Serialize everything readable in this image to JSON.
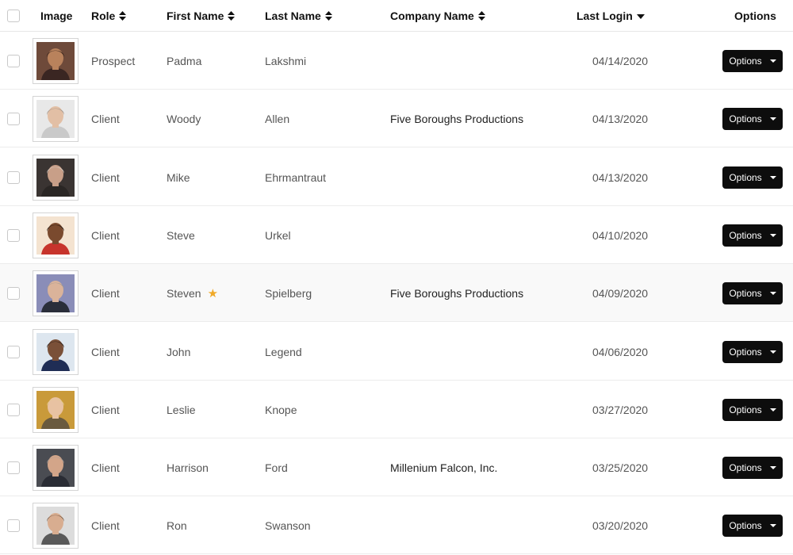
{
  "header": {
    "image": "Image",
    "role": "Role",
    "first_name": "First Name",
    "last_name": "Last Name",
    "company": "Company Name",
    "last_login": "Last Login",
    "options": "Options"
  },
  "rows": [
    {
      "role": "Prospect",
      "first": "Padma",
      "last": "Lakshmi",
      "company": "",
      "login": "04/14/2020",
      "options": "Options",
      "starred": false,
      "colors": {
        "bg": "#6e4a3a",
        "skin": "#b9825c",
        "hair": "#2a1a14",
        "shirt": "#3a2622"
      }
    },
    {
      "role": "Client",
      "first": "Woody",
      "last": "Allen",
      "company": "Five Boroughs Productions",
      "login": "04/13/2020",
      "options": "Options",
      "starred": false,
      "colors": {
        "bg": "#e8e8e8",
        "skin": "#e2bfa5",
        "hair": "#9a8f86",
        "shirt": "#c9c9c9"
      }
    },
    {
      "role": "Client",
      "first": "Mike",
      "last": "Ehrmantraut",
      "company": "",
      "login": "04/13/2020",
      "options": "Options",
      "starred": false,
      "colors": {
        "bg": "#3a3432",
        "skin": "#c89f88",
        "hair": "#d8d2cc",
        "shirt": "#2a2624"
      }
    },
    {
      "role": "Client",
      "first": "Steve",
      "last": "Urkel",
      "company": "",
      "login": "04/10/2020",
      "options": "Options",
      "starred": false,
      "colors": {
        "bg": "#f4e3d0",
        "skin": "#7a4a2e",
        "hair": "#1a120e",
        "shirt": "#c7342c"
      }
    },
    {
      "role": "Client",
      "first": "Steven",
      "last": "Spielberg",
      "company": "Five Boroughs Productions",
      "login": "04/09/2020",
      "options": "Options",
      "starred": true,
      "colors": {
        "bg": "#8a8db8",
        "skin": "#dab39a",
        "hair": "#9a9592",
        "shirt": "#2a2e3a"
      }
    },
    {
      "role": "Client",
      "first": "John",
      "last": "Legend",
      "company": "",
      "login": "04/06/2020",
      "options": "Options",
      "starred": false,
      "colors": {
        "bg": "#dde6ef",
        "skin": "#7a5038",
        "hair": "#1d1410",
        "shirt": "#1f2d55"
      }
    },
    {
      "role": "Client",
      "first": "Leslie",
      "last": "Knope",
      "company": "",
      "login": "03/27/2020",
      "options": "Options",
      "starred": false,
      "colors": {
        "bg": "#c99a3a",
        "skin": "#e8c2a2",
        "hair": "#e3cd8c",
        "shirt": "#6a5a3e"
      }
    },
    {
      "role": "Client",
      "first": "Harrison",
      "last": "Ford",
      "company": "Millenium Falcon, Inc.",
      "login": "03/25/2020",
      "options": "Options",
      "starred": false,
      "colors": {
        "bg": "#4a4c52",
        "skin": "#d3a589",
        "hair": "#a39c96",
        "shirt": "#2a2c34"
      }
    },
    {
      "role": "Client",
      "first": "Ron",
      "last": "Swanson",
      "company": "",
      "login": "03/20/2020",
      "options": "Options",
      "starred": false,
      "colors": {
        "bg": "#dcdcdc",
        "skin": "#d8ad90",
        "hair": "#6a5240",
        "shirt": "#5a5a5a"
      }
    }
  ],
  "icons": {
    "sort": "sort-both-icon",
    "sort_desc": "sort-desc-icon",
    "star": "star-icon",
    "caret": "caret-down-icon",
    "checkbox": "checkbox-icon"
  },
  "colors": {
    "button_bg": "#0d0d0d",
    "star": "#f0a928",
    "row_alt": "#f9f9f9",
    "border": "#ececec"
  }
}
